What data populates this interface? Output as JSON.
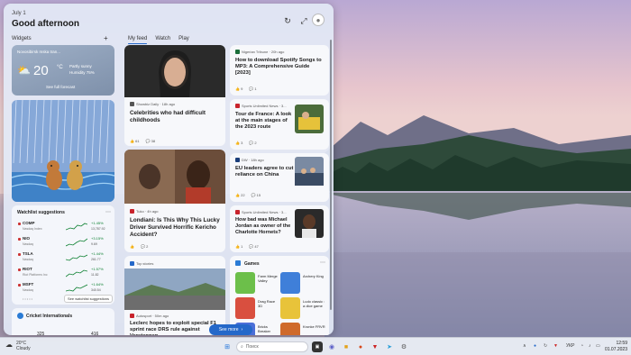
{
  "board": {
    "date": "July 1",
    "greeting": "Good afternoon",
    "widgets_label": "Widgets",
    "add_label": "+",
    "refresh_icon": "refresh-icon",
    "expand_icon": "expand-icon",
    "avatar_icon": "person-icon"
  },
  "tabs": [
    {
      "label": "My feed",
      "active": true
    },
    {
      "label": "Watch",
      "active": false
    },
    {
      "label": "Play",
      "active": false
    }
  ],
  "weather": {
    "location": "Novosibirsk mska tran...",
    "temp": "20",
    "unit": "°C",
    "condition": "Partly sunny",
    "humidity": "Humidity 75%",
    "forecast": "See full forecast"
  },
  "watchlist": {
    "title": "Watchlist suggestions",
    "rows": [
      {
        "symbol": "COMP",
        "exchange": "Nasdaq Index",
        "change": "+1.45%",
        "price": "13,787.92"
      },
      {
        "symbol": "NIO",
        "exchange": "Nasdaq",
        "change": "+3.15%",
        "price": "9.69"
      },
      {
        "symbol": "TSLA",
        "exchange": "Nasdaq",
        "change": "+1.44%",
        "price": "261.77"
      },
      {
        "symbol": "RIOT",
        "exchange": "Riot Platforms Inc",
        "change": "+1.57%",
        "price": "11.82"
      },
      {
        "symbol": "MSFT",
        "exchange": "Nasdaq",
        "change": "+1.64%",
        "price": "340.54"
      }
    ],
    "see_all": "See watchlist suggestions"
  },
  "cricket": {
    "title": "Cricket Internationals",
    "score1": "325",
    "score2": "416"
  },
  "feed": {
    "card1": {
      "source": "Showbiz Daily · 18h ago",
      "headline": "Celebrities who had difficult childhoods",
      "likes": "61",
      "comments": "38"
    },
    "card2": {
      "source": "Tuko · 4h ago",
      "headline": "Londiani: Is This Why This Lucky Driver Survived Horrific Kericho Accident?",
      "likes": "",
      "comments": "2"
    },
    "card3": {
      "source": "Top stories",
      "sub_source": "Autosport · 50m ago",
      "headline": "Leclerc hopes to exploit special F1 sprint race DRS rule against Verstappen"
    },
    "card4": {
      "source": "Nigerian Tribune · 20h ago",
      "headline": "How to download Spotify Songs to MP3: A Comprehensive Guide [2023]",
      "likes": "9",
      "comments": "1"
    },
    "card5": {
      "source": "Sports Unlimited News · 3...",
      "headline": "Tour de France: A look at the main stages of the 2023 route",
      "likes": "3",
      "comments": "2"
    },
    "card6": {
      "source": "DW · 18h ago",
      "headline": "EU leaders agree to cut reliance on China",
      "likes": "22",
      "comments": "15"
    },
    "card7": {
      "source": "Sports Unlimited News · 3...",
      "headline": "How bad was Michael Jordan as owner of the Charlotte Hornets?",
      "likes": "1",
      "comments": "47"
    }
  },
  "see_more": "See more",
  "games": {
    "title": "Games",
    "items": [
      {
        "name": "Farm Merge Valley",
        "color": "#6cbf4a"
      },
      {
        "name": "Archery King",
        "color": "#3f7fd9"
      },
      {
        "name": "Drag Race 3D",
        "color": "#d94f3f"
      },
      {
        "name": "Ludo classic : a dice game",
        "color": "#e8c33a"
      },
      {
        "name": "Bricks Breaker",
        "color": "#4b6fd8"
      },
      {
        "name": "Kronke FRVR",
        "color": "#cf6a2b"
      }
    ]
  },
  "taskbar": {
    "weather_temp": "20°C",
    "weather_cond": "Cloudy",
    "search_placeholder": "Поиск",
    "lang": "УКР",
    "time": "12:59",
    "date": "01.07.2023"
  }
}
